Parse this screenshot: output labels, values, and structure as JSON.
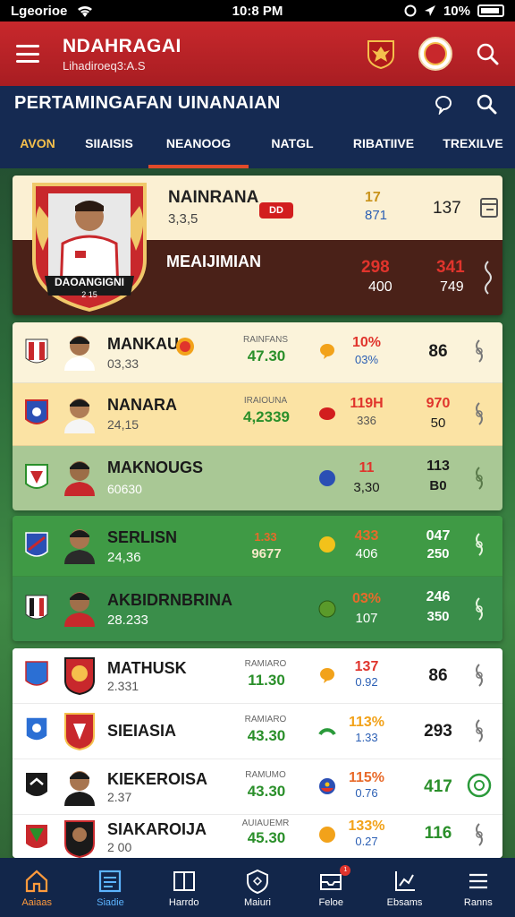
{
  "status_bar": {
    "carrier": "Lgeorioe",
    "time": "10:8 PM",
    "battery": "10%"
  },
  "header": {
    "title": "NDAHRAGAI",
    "subtitle": "Lihadiroeq3:A.S"
  },
  "section": {
    "title": "PERTAMINGAFAN UINANAIAN",
    "tabs": [
      {
        "label": "AVON"
      },
      {
        "label": "SIIAISIS"
      },
      {
        "label": "NEANOOG"
      },
      {
        "label": "NATGL"
      },
      {
        "label": "RIBATIIVE"
      },
      {
        "label": "TREXILVE"
      }
    ]
  },
  "featured": {
    "crest_text": "DAOANGIGNI",
    "crest_sub": "2 15",
    "name": "NAINRANA",
    "sub": "3,3,5",
    "pill": "DD",
    "v1a": "17",
    "v1b": "871",
    "v2": "137",
    "label": "MEAIJIMIAN",
    "b1a": "298",
    "b1b": "400",
    "b2a": "341",
    "b2b": "749"
  },
  "rows": [
    {
      "name": "MANKAU",
      "sub": "03,33",
      "stat_label": "RAINFANS",
      "stat": "47.30",
      "pct": "10%",
      "pct2": "03%",
      "score": "86",
      "score2": ""
    },
    {
      "name": "NANARA",
      "sub": "24,15",
      "stat_label": "IRAIOUNA",
      "stat": "4,2339",
      "pct": "119H",
      "pct2": "336",
      "score": "970",
      "score2": "50"
    },
    {
      "name": "MAKNOUGS",
      "sub": "60630",
      "stat_label": "",
      "stat": "",
      "pct": "11",
      "pct2": "3,30",
      "score": "113",
      "score2": "B0"
    },
    {
      "name": "SERLISN",
      "sub": "24,36",
      "stat_label": "1.33",
      "stat": "9677",
      "pct": "433",
      "pct2": "406",
      "score": "047",
      "score2": "250"
    },
    {
      "name": "AKBIDRNBRINA",
      "sub": "28.233",
      "stat_label": "",
      "stat": "",
      "pct": "03%",
      "pct2": "107",
      "score": "246",
      "score2": "350"
    },
    {
      "name": "MATHUSK",
      "sub": "2.331",
      "stat_label": "RAMIARO",
      "stat": "11.30",
      "pct": "137",
      "pct2": "0.92",
      "score": "86",
      "score2": ""
    },
    {
      "name": "SIEIASIA",
      "sub": "",
      "stat_label": "RAMIARO",
      "stat": "43.30",
      "pct": "113%",
      "pct2": "1.33",
      "score": "293",
      "score2": ""
    },
    {
      "name": "KIEKEROISA",
      "sub": "2.37",
      "stat_label": "RAMUMO",
      "stat": "43.30",
      "pct": "115%",
      "pct2": "0.76",
      "score": "417",
      "score2": ""
    },
    {
      "name": "SIAKAROIJA",
      "sub": "2 00",
      "stat_label": "AUIAUEMR",
      "stat": "45.30",
      "pct": "133%",
      "pct2": "0.27",
      "score": "116",
      "score2": ""
    }
  ],
  "nav": [
    {
      "label": "Aaiaas"
    },
    {
      "label": "Siadie"
    },
    {
      "label": "Harrdo"
    },
    {
      "label": "Maiuri"
    },
    {
      "label": "Feloe"
    },
    {
      "label": "Ebsams"
    },
    {
      "label": "Ranns"
    }
  ],
  "colors": {
    "header_red": "#c8282c",
    "navy": "#152a52",
    "accent_orange": "#e04a2a",
    "green_stat": "#2a8f2a",
    "red_stat": "#e0342c"
  }
}
